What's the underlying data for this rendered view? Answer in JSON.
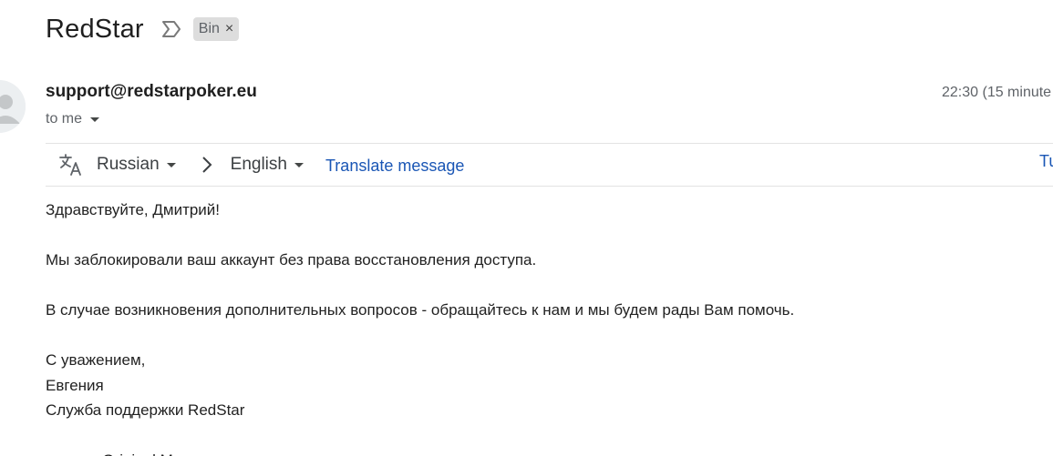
{
  "email": {
    "subject": "RedStar",
    "label": "Bin",
    "label_remove": "×",
    "sender": "support@redstarpoker.eu",
    "timestamp": "22:30 (15 minute",
    "recipient": "to me"
  },
  "translate": {
    "from_language": "Russian",
    "to_language": "English",
    "translate_label": "Translate message",
    "turn_off_label": "Tu"
  },
  "body": {
    "greeting": "Здравствуйте, Дмитрий!",
    "paragraph1": "Мы заблокировали ваш аккаунт без права восстановления доступа.",
    "paragraph2": "В случае возникновения дополнительных вопросов - обращайтесь к нам и мы будем рады Вам помочь.",
    "closing": "С уважением,",
    "signer": "Евгения",
    "team": "Служба поддержки RedStar",
    "original_message": "-----Original Message-----"
  },
  "colors": {
    "link": "#1a56b5",
    "label_chip_bg": "#dddddd",
    "muted_text": "#5f6368"
  },
  "icons": {
    "important": "important-marker-icon",
    "translate": "translate-icon",
    "arrow": "chevron-right-icon",
    "avatar": "default-avatar-icon",
    "dropdown": "caret-down-icon"
  }
}
